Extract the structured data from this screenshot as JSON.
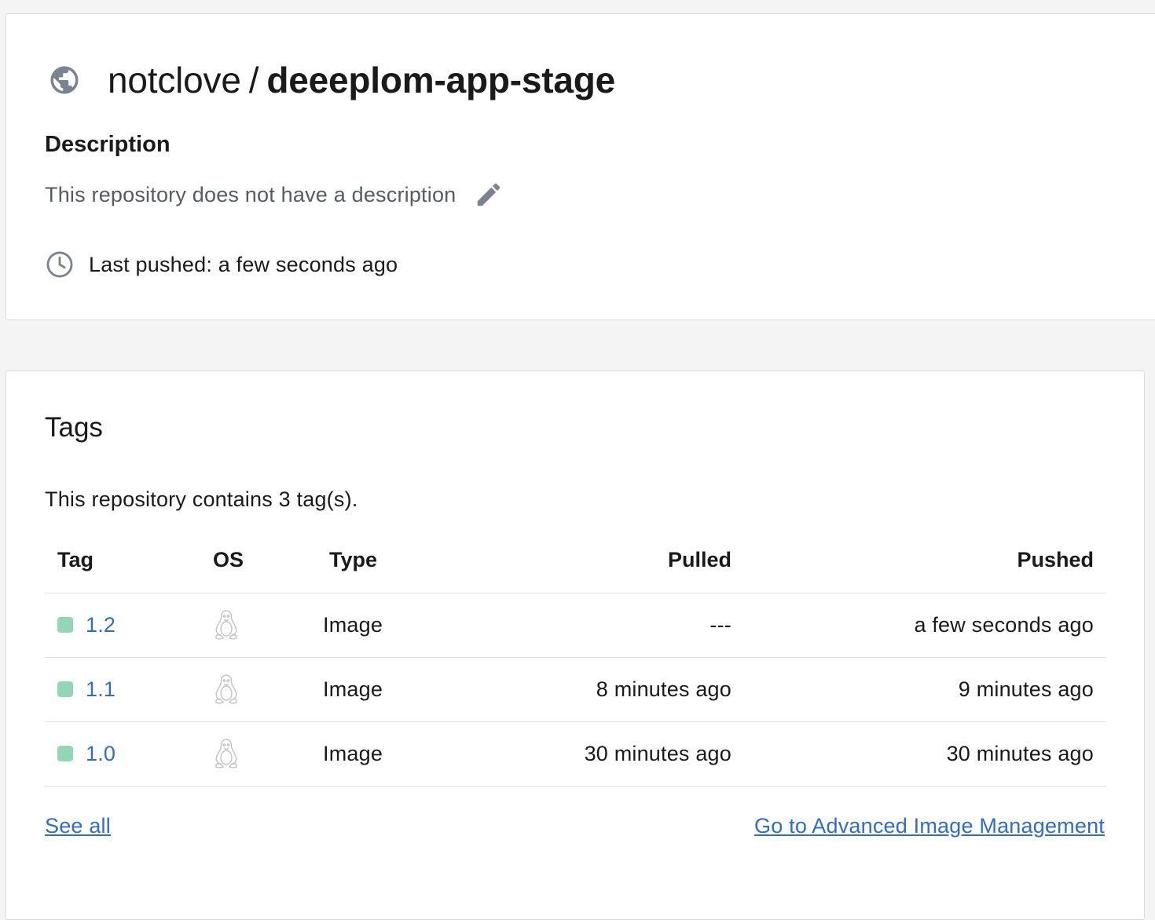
{
  "repo": {
    "namespace": "notclove",
    "separator": "/",
    "name": "deeeplom-app-stage",
    "visibility_icon": "globe-icon"
  },
  "description": {
    "heading": "Description",
    "text": "This repository does not have a description",
    "edit_icon": "pencil-icon"
  },
  "last_pushed": {
    "icon": "clock-icon",
    "text": "Last pushed: a few seconds ago"
  },
  "tags": {
    "heading": "Tags",
    "count_text": "This repository contains 3 tag(s).",
    "columns": [
      "Tag",
      "OS",
      "Type",
      "Pulled",
      "Pushed"
    ],
    "rows": [
      {
        "tag": "1.2",
        "os_icon": "linux-icon",
        "type": "Image",
        "pulled": "---",
        "pushed": "a few seconds ago"
      },
      {
        "tag": "1.1",
        "os_icon": "linux-icon",
        "type": "Image",
        "pulled": "8 minutes ago",
        "pushed": "9 minutes ago"
      },
      {
        "tag": "1.0",
        "os_icon": "linux-icon",
        "type": "Image",
        "pulled": "30 minutes ago",
        "pushed": "30 minutes ago"
      }
    ],
    "see_all_label": "See all",
    "advanced_label": "Go to Advanced Image Management"
  },
  "colors": {
    "link": "#2f6dcc",
    "tag_status": "#93d6b4",
    "icon_gray": "#7b8290"
  }
}
